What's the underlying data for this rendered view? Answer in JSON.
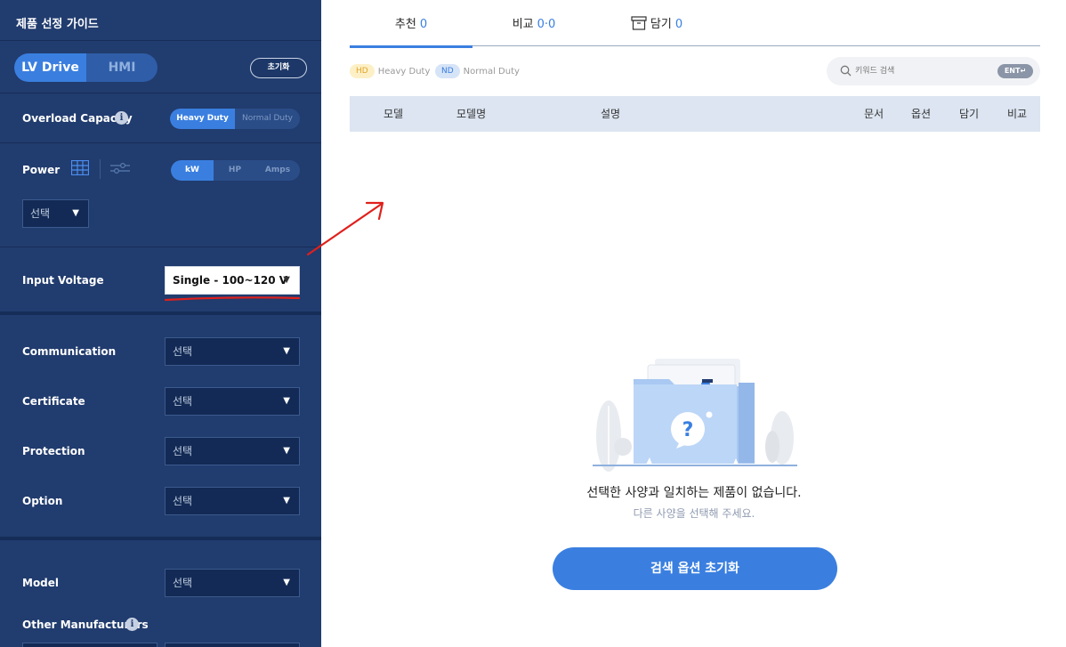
{
  "sidebar": {
    "title": "제품 선정 가이드",
    "product_toggle": {
      "active": "LV Drive",
      "inactive": "HMI"
    },
    "reset_label": "초기화",
    "overload": {
      "label": "Overload Capacity",
      "info_icon": "i",
      "options": [
        "Heavy Duty",
        "Normal Duty"
      ],
      "selected": "Heavy Duty"
    },
    "power": {
      "label": "Power",
      "unit_options": [
        "kW",
        "HP",
        "Amps"
      ],
      "selected_unit": "kW",
      "select_value": "선택"
    },
    "input_voltage": {
      "label": "Input Voltage",
      "value": "Single - 100~120 V"
    },
    "communication": {
      "label": "Communication",
      "value": "선택"
    },
    "certificate": {
      "label": "Certificate",
      "value": "선택"
    },
    "protection": {
      "label": "Protection",
      "value": "선택"
    },
    "option": {
      "label": "Option",
      "value": "선택"
    },
    "model": {
      "label": "Model",
      "value": "선택"
    },
    "other_manufacturers": {
      "label": "Other Manufacturers",
      "info_icon": "i"
    },
    "dropdown_arrow": "▼"
  },
  "tabs": [
    {
      "label": "추천",
      "count": "0"
    },
    {
      "label": "비교",
      "count": "0·0"
    },
    {
      "label": "담기",
      "count": "0"
    }
  ],
  "legend": {
    "hd_badge": "HD",
    "hd_text": "Heavy Duty",
    "nd_badge": "ND",
    "nd_text": "Normal Duty"
  },
  "search": {
    "placeholder": "키워드 검색",
    "ent_label": "ENT↵"
  },
  "table": {
    "headers": [
      "모델",
      "모델명",
      "설명",
      "문서",
      "옵션",
      "담기",
      "비교"
    ]
  },
  "empty_state": {
    "title": "선택한 사양과 일치하는 제품이 없습니다.",
    "subtitle": "다른 사양을 선택해 주세요.",
    "button": "검색 옵션 초기화"
  },
  "colors": {
    "sidebar_bg": "#213c6e",
    "accent": "#3a7fe0",
    "annotation": "#e0201c"
  },
  "icons": {
    "grid": "grid-icon",
    "slider": "slider-icon",
    "box": "box-icon",
    "search": "search-icon",
    "info": "info-icon"
  }
}
